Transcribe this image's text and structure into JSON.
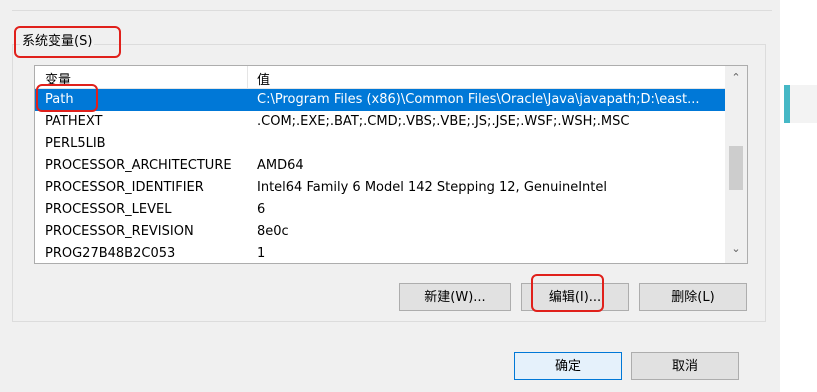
{
  "group": {
    "label": "系统变量(S)"
  },
  "list": {
    "headers": {
      "name": "变量",
      "value": "值"
    },
    "rows": [
      {
        "name": "Path",
        "value": "C:\\Program Files (x86)\\Common Files\\Oracle\\Java\\javapath;D:\\east...",
        "selected": true
      },
      {
        "name": "PATHEXT",
        "value": ".COM;.EXE;.BAT;.CMD;.VBS;.VBE;.JS;.JSE;.WSF;.WSH;.MSC",
        "selected": false
      },
      {
        "name": "PERL5LIB",
        "value": "",
        "selected": false
      },
      {
        "name": "PROCESSOR_ARCHITECTURE",
        "value": "AMD64",
        "selected": false
      },
      {
        "name": "PROCESSOR_IDENTIFIER",
        "value": "Intel64 Family 6 Model 142 Stepping 12, GenuineIntel",
        "selected": false
      },
      {
        "name": "PROCESSOR_LEVEL",
        "value": "6",
        "selected": false
      },
      {
        "name": "PROCESSOR_REVISION",
        "value": "8e0c",
        "selected": false
      },
      {
        "name": "PROG27B48B2C053",
        "value": "1",
        "selected": false
      }
    ],
    "scrollbar": {
      "up_icon": "chevron-up-icon",
      "down_icon": "chevron-down-icon"
    }
  },
  "buttons": {
    "new": "新建(W)...",
    "edit": "编辑(I)...",
    "delete": "删除(L)",
    "ok": "确定",
    "cancel": "取消"
  },
  "colors": {
    "selection": "#0078d7",
    "highlight": "#e0201b",
    "accent": "#46b8c6"
  }
}
